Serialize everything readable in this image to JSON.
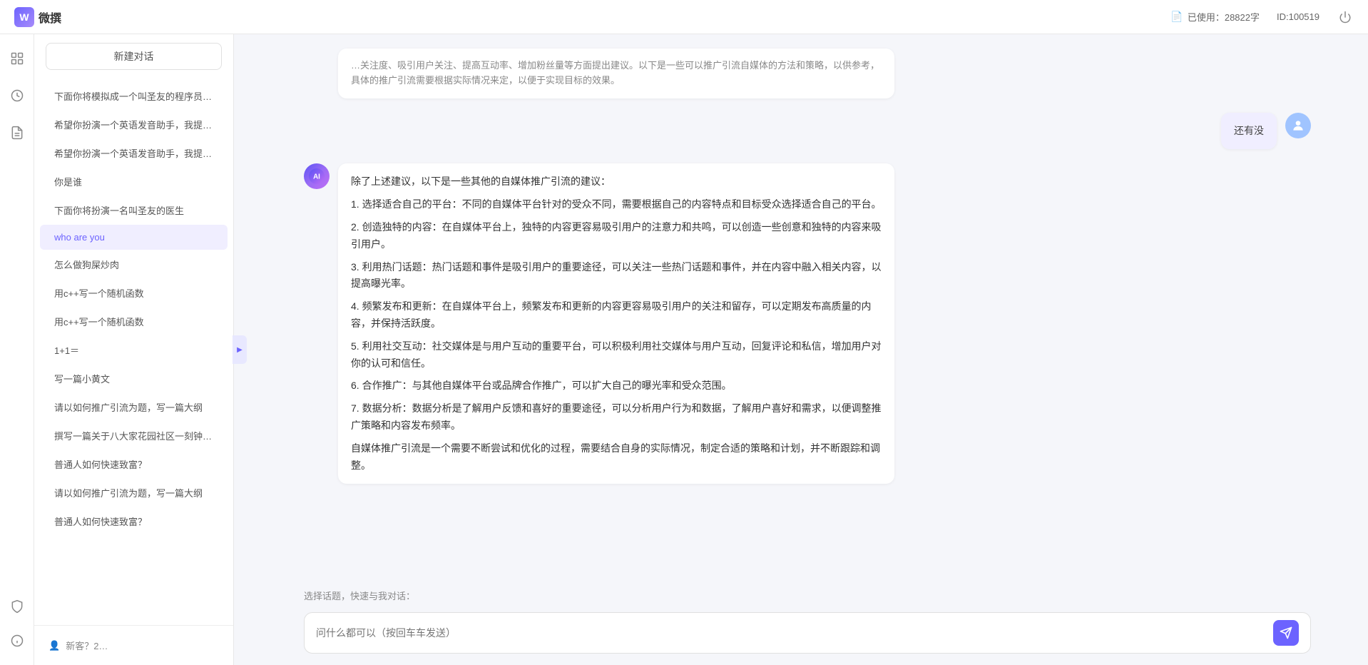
{
  "app": {
    "title": "微撰",
    "usage_label": "已使用：28822字",
    "usage_icon": "document-icon",
    "id_label": "ID:100519"
  },
  "icon_bar": {
    "items": [
      {
        "name": "home-icon",
        "symbol": "⊞"
      },
      {
        "name": "clock-icon",
        "symbol": "⏰"
      },
      {
        "name": "note-icon",
        "symbol": "📝"
      }
    ],
    "bottom": [
      {
        "name": "shield-icon",
        "symbol": "🛡"
      },
      {
        "name": "info-icon",
        "symbol": "ℹ"
      }
    ]
  },
  "sidebar": {
    "new_btn_label": "新建对话",
    "items": [
      {
        "label": "下面你将模拟成一个叫圣友的程序员，我说…",
        "active": false
      },
      {
        "label": "希望你扮演一个英语发音助手，我提供给你…",
        "active": false
      },
      {
        "label": "希望你扮演一个英语发音助手，我提供给你…",
        "active": false
      },
      {
        "label": "你是谁",
        "active": false
      },
      {
        "label": "下面你将扮演一名叫圣友的医生",
        "active": false
      },
      {
        "label": "who are you",
        "active": true
      },
      {
        "label": "怎么做狗屎炒肉",
        "active": false
      },
      {
        "label": "用c++写一个随机函数",
        "active": false
      },
      {
        "label": "用c++写一个随机函数",
        "active": false
      },
      {
        "label": "1+1＝",
        "active": false
      },
      {
        "label": "写一篇小黄文",
        "active": false
      },
      {
        "label": "请以如何推广引流为题，写一篇大纲",
        "active": false
      },
      {
        "label": "撰写一篇关于八大家花园社区一刻钟便民生…",
        "active": false
      },
      {
        "label": "普通人如何快速致富？",
        "active": false
      },
      {
        "label": "请以如何推广引流为题，写一篇大纲",
        "active": false
      },
      {
        "label": "普通人如何快速致富？",
        "active": false
      }
    ],
    "bottom_items": [
      {
        "label": "新客？2…",
        "icon": "user-icon"
      }
    ]
  },
  "chat": {
    "messages": [
      {
        "role": "truncated",
        "content": "…关注度、吸引用户关注、提高互动率、增加粉丝量等方面提出建议。以下是一些可以推广引流自媒体的方法和策略，以供参考，具体的推广引流需要根据实际情况来定，以便于实现目标的效果。"
      },
      {
        "role": "user",
        "content": "还有没"
      },
      {
        "role": "ai",
        "content_paragraphs": [
          "除了上述建议，以下是一些其他的自媒体推广引流的建议：",
          "1. 选择适合自己的平台：不同的自媒体平台针对的受众不同，需要根据自己的内容特点和目标受众选择适合自己的平台。",
          "2. 创造独特的内容：在自媒体平台上，独特的内容更容易吸引用户的注意力和共鸣，可以创造一些创意和独特的内容来吸引用户。",
          "3. 利用热门话题：热门话题和事件是吸引用户的重要途径，可以关注一些热门话题和事件，并在内容中融入相关内容，以提高曝光率。",
          "4. 频繁发布和更新：在自媒体平台上，频繁发布和更新的内容更容易吸引用户的关注和留存，可以定期发布高质量的内容，并保持活跃度。",
          "5. 利用社交互动：社交媒体是与用户互动的重要平台，可以积极利用社交媒体与用户互动，回复评论和私信，增加用户对你的认可和信任。",
          "6. 合作推广：与其他自媒体平台或品牌合作推广，可以扩大自己的曝光率和受众范围。",
          "7. 数据分析：数据分析是了解用户反馈和喜好的重要途径，可以分析用户行为和数据，了解用户喜好和需求，以便调整推广策略和内容发布频率。",
          "自媒体推广引流是一个需要不断尝试和优化的过程，需要结合自身的实际情况，制定合适的策略和计划，并不断跟踪和调整。"
        ]
      }
    ],
    "quick_topics_label": "选择话题，快速与我对话：",
    "input_placeholder": "问什么都可以（按回车车发送）",
    "send_icon": "send-icon"
  }
}
